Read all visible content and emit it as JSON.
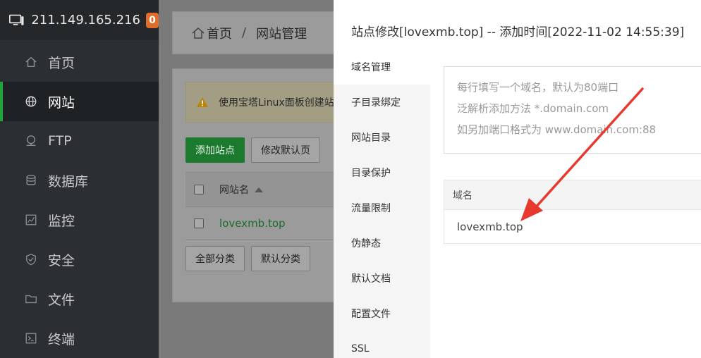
{
  "sidebar": {
    "server_ip": "211.149.165.216",
    "badge_count": "0",
    "items": [
      {
        "label": "首页",
        "icon": "home-icon"
      },
      {
        "label": "网站",
        "icon": "globe-icon"
      },
      {
        "label": "FTP",
        "icon": "ftp-icon"
      },
      {
        "label": "数据库",
        "icon": "database-icon"
      },
      {
        "label": "监控",
        "icon": "monitor-chart-icon"
      },
      {
        "label": "安全",
        "icon": "shield-icon"
      },
      {
        "label": "文件",
        "icon": "folder-icon"
      },
      {
        "label": "终端",
        "icon": "terminal-icon"
      }
    ],
    "active_item": "网站",
    "accent_color": "#20a53a",
    "badge_color": "#e06d2b"
  },
  "breadcrumb": {
    "home": "首页",
    "separator": "/",
    "current": "网站管理"
  },
  "notice": {
    "text": "使用宝塔Linux面板创建站"
  },
  "toolbar": {
    "add_site": "添加站点",
    "modify_default": "修改默认页"
  },
  "site_table": {
    "col_name": "网站名",
    "rows": [
      {
        "name": "lovexmb.top"
      }
    ]
  },
  "categories": {
    "all": "全部分类",
    "default": "默认分类"
  },
  "modal": {
    "title": "站点修改[lovexmb.top] -- 添加时间[2022-11-02 14:55:39]",
    "tabs": [
      "域名管理",
      "子目录绑定",
      "网站目录",
      "目录保护",
      "流量限制",
      "伪静态",
      "默认文档",
      "配置文件",
      "SSL"
    ],
    "active_tab": "域名管理",
    "textarea_placeholder_lines": [
      "每行填写一个域名，默认为80端口",
      "泛解析添加方法 *.domain.com",
      "如另加端口格式为 www.domain.com:88"
    ],
    "domain_table": {
      "header": "域名",
      "rows": [
        "lovexmb.top"
      ]
    }
  },
  "annotation": {
    "arrow_color": "#e8392f"
  }
}
